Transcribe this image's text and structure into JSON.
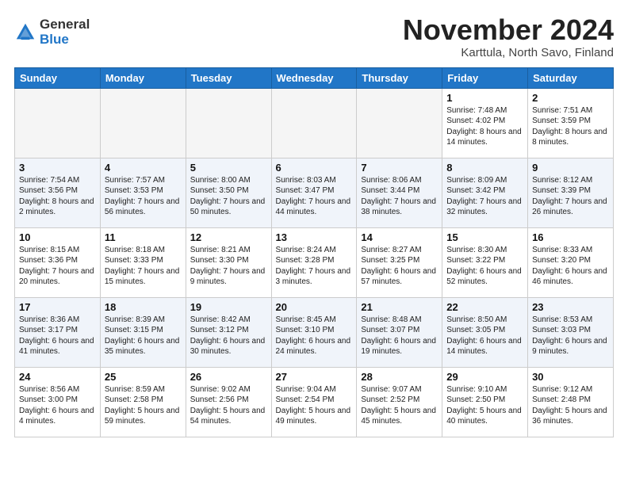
{
  "header": {
    "logo": {
      "text_general": "General",
      "text_blue": "Blue"
    },
    "title": "November 2024",
    "location": "Karttula, North Savo, Finland"
  },
  "weekdays": [
    "Sunday",
    "Monday",
    "Tuesday",
    "Wednesday",
    "Thursday",
    "Friday",
    "Saturday"
  ],
  "weeks": [
    [
      {
        "day": "",
        "info": ""
      },
      {
        "day": "",
        "info": ""
      },
      {
        "day": "",
        "info": ""
      },
      {
        "day": "",
        "info": ""
      },
      {
        "day": "",
        "info": ""
      },
      {
        "day": "1",
        "info": "Sunrise: 7:48 AM\nSunset: 4:02 PM\nDaylight: 8 hours and 14 minutes."
      },
      {
        "day": "2",
        "info": "Sunrise: 7:51 AM\nSunset: 3:59 PM\nDaylight: 8 hours and 8 minutes."
      }
    ],
    [
      {
        "day": "3",
        "info": "Sunrise: 7:54 AM\nSunset: 3:56 PM\nDaylight: 8 hours and 2 minutes."
      },
      {
        "day": "4",
        "info": "Sunrise: 7:57 AM\nSunset: 3:53 PM\nDaylight: 7 hours and 56 minutes."
      },
      {
        "day": "5",
        "info": "Sunrise: 8:00 AM\nSunset: 3:50 PM\nDaylight: 7 hours and 50 minutes."
      },
      {
        "day": "6",
        "info": "Sunrise: 8:03 AM\nSunset: 3:47 PM\nDaylight: 7 hours and 44 minutes."
      },
      {
        "day": "7",
        "info": "Sunrise: 8:06 AM\nSunset: 3:44 PM\nDaylight: 7 hours and 38 minutes."
      },
      {
        "day": "8",
        "info": "Sunrise: 8:09 AM\nSunset: 3:42 PM\nDaylight: 7 hours and 32 minutes."
      },
      {
        "day": "9",
        "info": "Sunrise: 8:12 AM\nSunset: 3:39 PM\nDaylight: 7 hours and 26 minutes."
      }
    ],
    [
      {
        "day": "10",
        "info": "Sunrise: 8:15 AM\nSunset: 3:36 PM\nDaylight: 7 hours and 20 minutes."
      },
      {
        "day": "11",
        "info": "Sunrise: 8:18 AM\nSunset: 3:33 PM\nDaylight: 7 hours and 15 minutes."
      },
      {
        "day": "12",
        "info": "Sunrise: 8:21 AM\nSunset: 3:30 PM\nDaylight: 7 hours and 9 minutes."
      },
      {
        "day": "13",
        "info": "Sunrise: 8:24 AM\nSunset: 3:28 PM\nDaylight: 7 hours and 3 minutes."
      },
      {
        "day": "14",
        "info": "Sunrise: 8:27 AM\nSunset: 3:25 PM\nDaylight: 6 hours and 57 minutes."
      },
      {
        "day": "15",
        "info": "Sunrise: 8:30 AM\nSunset: 3:22 PM\nDaylight: 6 hours and 52 minutes."
      },
      {
        "day": "16",
        "info": "Sunrise: 8:33 AM\nSunset: 3:20 PM\nDaylight: 6 hours and 46 minutes."
      }
    ],
    [
      {
        "day": "17",
        "info": "Sunrise: 8:36 AM\nSunset: 3:17 PM\nDaylight: 6 hours and 41 minutes."
      },
      {
        "day": "18",
        "info": "Sunrise: 8:39 AM\nSunset: 3:15 PM\nDaylight: 6 hours and 35 minutes."
      },
      {
        "day": "19",
        "info": "Sunrise: 8:42 AM\nSunset: 3:12 PM\nDaylight: 6 hours and 30 minutes."
      },
      {
        "day": "20",
        "info": "Sunrise: 8:45 AM\nSunset: 3:10 PM\nDaylight: 6 hours and 24 minutes."
      },
      {
        "day": "21",
        "info": "Sunrise: 8:48 AM\nSunset: 3:07 PM\nDaylight: 6 hours and 19 minutes."
      },
      {
        "day": "22",
        "info": "Sunrise: 8:50 AM\nSunset: 3:05 PM\nDaylight: 6 hours and 14 minutes."
      },
      {
        "day": "23",
        "info": "Sunrise: 8:53 AM\nSunset: 3:03 PM\nDaylight: 6 hours and 9 minutes."
      }
    ],
    [
      {
        "day": "24",
        "info": "Sunrise: 8:56 AM\nSunset: 3:00 PM\nDaylight: 6 hours and 4 minutes."
      },
      {
        "day": "25",
        "info": "Sunrise: 8:59 AM\nSunset: 2:58 PM\nDaylight: 5 hours and 59 minutes."
      },
      {
        "day": "26",
        "info": "Sunrise: 9:02 AM\nSunset: 2:56 PM\nDaylight: 5 hours and 54 minutes."
      },
      {
        "day": "27",
        "info": "Sunrise: 9:04 AM\nSunset: 2:54 PM\nDaylight: 5 hours and 49 minutes."
      },
      {
        "day": "28",
        "info": "Sunrise: 9:07 AM\nSunset: 2:52 PM\nDaylight: 5 hours and 45 minutes."
      },
      {
        "day": "29",
        "info": "Sunrise: 9:10 AM\nSunset: 2:50 PM\nDaylight: 5 hours and 40 minutes."
      },
      {
        "day": "30",
        "info": "Sunrise: 9:12 AM\nSunset: 2:48 PM\nDaylight: 5 hours and 36 minutes."
      }
    ]
  ]
}
